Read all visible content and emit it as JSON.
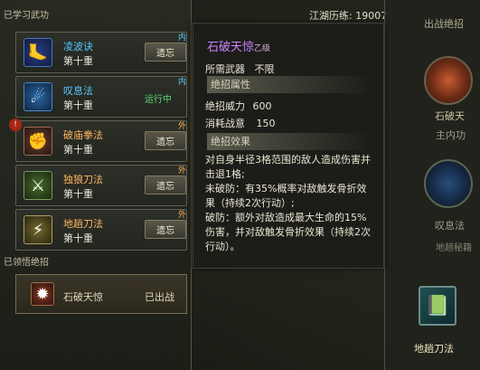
{
  "left_panel": {
    "learned_title": "已学习武功",
    "skills": [
      {
        "name": "凌波诀",
        "level": "第十重",
        "action": "遗忘",
        "tag": "内",
        "name_color": "#55c7ff",
        "icon": "feet-icon"
      },
      {
        "name": "叹息法",
        "level": "第十重",
        "status": "运行中",
        "tag": "内",
        "name_color": "#55c7ff",
        "icon": "blue-spirit-icon"
      },
      {
        "name": "破庙拳法",
        "level": "第十重",
        "action": "遗忘",
        "tag": "外",
        "name_color": "#ffb45e",
        "icon": "fist-icon"
      },
      {
        "name": "独狼刀法",
        "level": "第十重",
        "action": "遗忘",
        "tag": "外",
        "name_color": "#ffb45e",
        "icon": "wolf-blade-icon"
      },
      {
        "name": "地趟刀法",
        "level": "第十重",
        "action": "遗忘",
        "tag": "外",
        "name_color": "#ffb45e",
        "icon": "ground-blade-icon"
      }
    ],
    "ultimate_title": "已领悟绝招",
    "ultimate": {
      "name": "石破天惊",
      "status": "已出战",
      "icon": "stone-burst-icon"
    }
  },
  "header": {
    "exp_label": "江湖历练:",
    "exp_value": "19007"
  },
  "tooltip": {
    "title": "石破天惊",
    "grade": "乙级",
    "weapon_label": "所需武器",
    "weapon_value": "不限",
    "attr_section": "绝招属性",
    "power_label": "绝招威力",
    "power_value": "600",
    "cost_label": "消耗战意",
    "cost_value": "150",
    "effect_section": "绝招效果",
    "desc_1": "对自身半径3格范围的敌人造成伤害并击退1格;",
    "desc_2": "未破防：有35%概率对敌触发骨折效果（持续2次行动）;",
    "desc_3": "破防：额外对敌造成最大生命的15%伤害，并对敌触发骨折效果（持续2次行动）。"
  },
  "right_panel": {
    "partial_title": "出战绝招",
    "slot_1": "石破天",
    "slot_2": "主内功",
    "slot_3": "叹息法",
    "slot_4": "地趟刀法",
    "slot_4_partial": "地趟秘籍"
  }
}
